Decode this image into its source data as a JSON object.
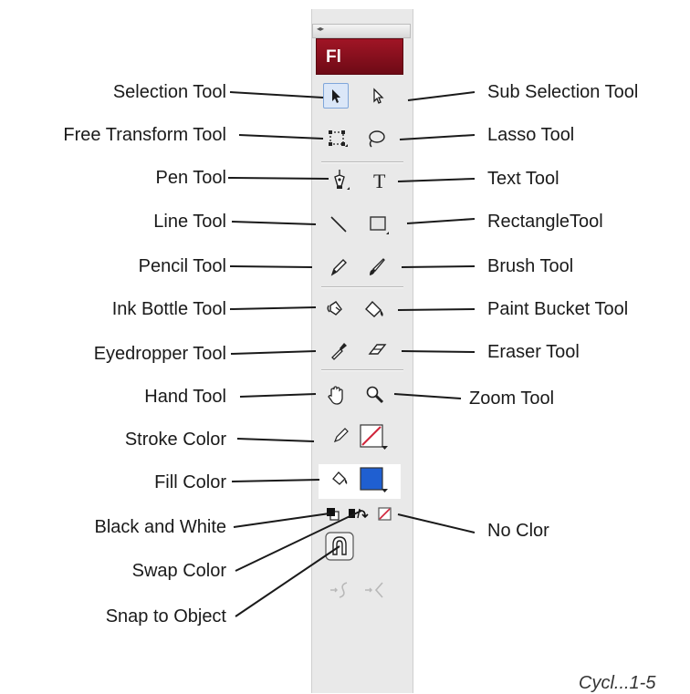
{
  "logo_text": "Fl",
  "labels_left": {
    "selection": "Selection Tool",
    "free_transform": "Free Transform Tool",
    "pen": "Pen Tool",
    "line": "Line Tool",
    "pencil": "Pencil Tool",
    "ink_bottle": "Ink Bottle Tool",
    "eyedropper": "Eyedropper Tool",
    "hand": "Hand Tool",
    "stroke_color": "Stroke Color",
    "fill_color": "Fill Color",
    "black_white": "Black and White",
    "swap_color": "Swap Color",
    "snap": "Snap to Object"
  },
  "labels_right": {
    "sub_selection": "Sub Selection Tool",
    "lasso": "Lasso Tool",
    "text": "Text Tool",
    "rectangle": "RectangleTool",
    "brush": "Brush Tool",
    "paint_bucket": "Paint Bucket Tool",
    "eraser": "Eraser Tool",
    "zoom": "Zoom Tool",
    "no_color": "No Clor"
  },
  "caption": "Cycl...1-5",
  "colors": {
    "fill_swatch": "#1f5fd1",
    "stroke_swatch": "#ffffff",
    "logo": "#8b0f1e",
    "no_color_slash": "#d0253b"
  },
  "icons": [
    "selection-arrow-icon",
    "sub-selection-arrow-icon",
    "free-transform-icon",
    "lasso-icon",
    "pen-icon",
    "text-icon",
    "line-icon",
    "rectangle-icon",
    "pencil-icon",
    "brush-icon",
    "ink-bottle-icon",
    "paint-bucket-icon",
    "eyedropper-icon",
    "eraser-icon",
    "hand-icon",
    "zoom-icon",
    "stroke-pencil-icon",
    "fill-bucket-icon",
    "black-white-icon",
    "swap-color-icon",
    "no-color-icon",
    "snap-magnet-icon",
    "smooth-icon",
    "straighten-icon"
  ]
}
